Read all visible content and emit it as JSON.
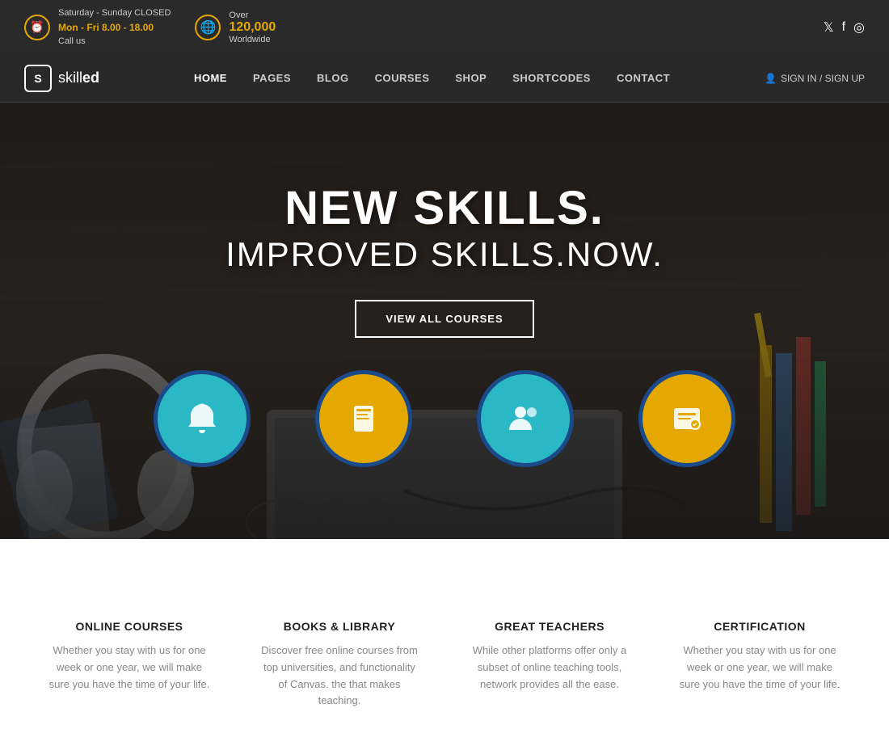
{
  "topbar": {
    "schedule_line1": "Saturday - Sunday CLOSED",
    "schedule_line2": "Mon - Fri 8.00 - 18.00",
    "call_label": "Call us",
    "globe_over": "Over",
    "globe_number": "120,000",
    "globe_text": "Worldwide"
  },
  "social": {
    "twitter": "𝕏",
    "facebook": "f",
    "instagram": "📷"
  },
  "navbar": {
    "logo_letter": "S",
    "logo_name": "skill",
    "logo_name_bold": "ed",
    "menu_items": [
      {
        "label": "HOME",
        "active": true
      },
      {
        "label": "PAGES",
        "active": false
      },
      {
        "label": "BLOG",
        "active": false
      },
      {
        "label": "COURSES",
        "active": false
      },
      {
        "label": "SHOP",
        "active": false
      },
      {
        "label": "SHORTCODES",
        "active": false
      },
      {
        "label": "CONTACT",
        "active": false
      }
    ],
    "signin_label": "SIGN IN / SIGN UP"
  },
  "hero": {
    "title_main": "NEW SKILLS.",
    "title_sub": "IMPROVED SKILLS.NOW.",
    "button_label": "VIEW ALL COURSES"
  },
  "features": [
    {
      "icon": "🔔",
      "bg": "blue",
      "title": "ONLINE COURSES",
      "text": "Whether you stay with us for one week or one year, we will make sure you have the time of your life."
    },
    {
      "icon": "📖",
      "bg": "yellow",
      "title": "BOOKS & LIBRARY",
      "text": "Discover free online courses from top universities, and functionality of Canvas. the that makes teaching."
    },
    {
      "icon": "👥",
      "bg": "blue",
      "title": "GREAT TEACHERS",
      "text": "While other platforms offer only a subset of online teaching tools, network provides all the ease."
    },
    {
      "icon": "🏆",
      "bg": "yellow",
      "title": "CERTIFICATION",
      "text": "Whether you stay with us for one week or one year, we will make sure you have the time of your life."
    }
  ],
  "colors": {
    "accent_yellow": "#e5a800",
    "accent_blue": "#29b8c4",
    "dark_border": "#1a3a6b",
    "nav_bg": "#1e1e1e",
    "topbar_bg": "#2a2a2a"
  }
}
